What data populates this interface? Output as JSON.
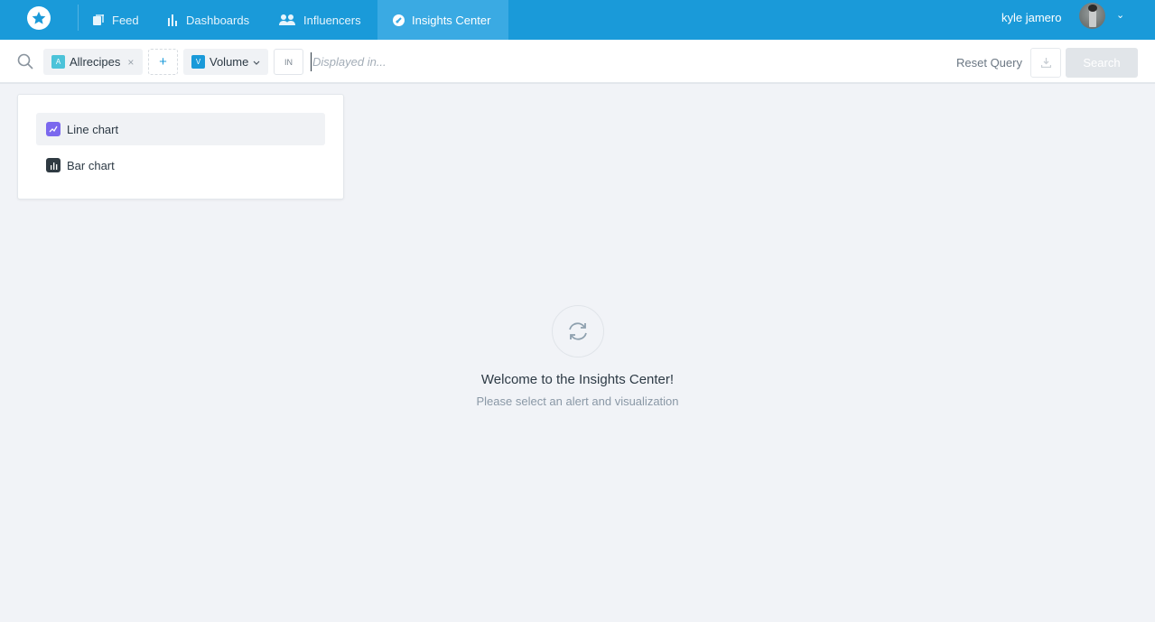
{
  "header": {
    "logo": "star-logo-icon",
    "nav": [
      {
        "label": "Feed",
        "icon": "feed-icon",
        "active": false
      },
      {
        "label": "Dashboards",
        "icon": "bar-chart-icon",
        "active": false
      },
      {
        "label": "Influencers",
        "icon": "users-icon",
        "active": false
      },
      {
        "label": "Insights Center",
        "icon": "gauge-icon",
        "active": true
      }
    ],
    "user": {
      "name": "kyle jamero",
      "avatar": "user-avatar"
    }
  },
  "query_bar": {
    "search_icon": "search-icon",
    "alert_chip": {
      "badge": "A",
      "label": "Allrecipes",
      "remove": "×"
    },
    "add_button": "+",
    "metric_chip": {
      "badge": "V",
      "label": "Volume",
      "chevron": "⌄"
    },
    "in_label": "IN",
    "displayed_in": {
      "value": "",
      "placeholder": "Displayed in..."
    },
    "reset_label": "Reset Query",
    "download_icon": "download-icon",
    "search_label": "Search"
  },
  "visualizations": [
    {
      "label": "Line chart",
      "icon": "line-chart-icon",
      "selected": true
    },
    {
      "label": "Bar chart",
      "icon": "bar-chart-icon",
      "selected": false
    }
  ],
  "empty_state": {
    "icon": "refresh-icon",
    "title": "Welcome to the Insights Center!",
    "subtitle": "Please select an alert and visualization"
  },
  "colors": {
    "brand": "#1a9ad9",
    "active_nav": "#3aaae3",
    "line_chart_icon": "#7b68ee",
    "alert_badge": "#4cc3d9"
  }
}
